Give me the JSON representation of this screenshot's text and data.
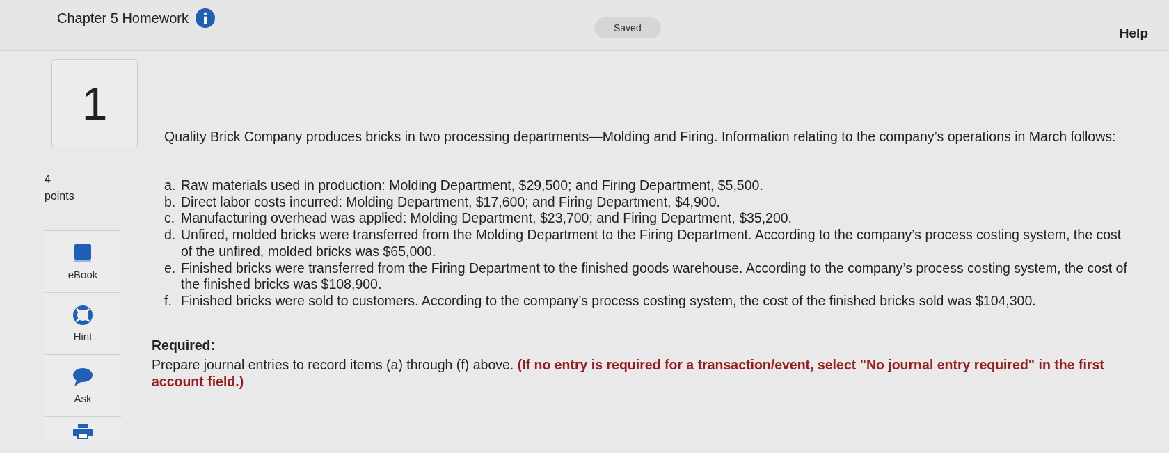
{
  "header": {
    "title": "Chapter 5 Homework",
    "status": "Saved",
    "help": "Help"
  },
  "question": {
    "number": "1",
    "points_value": "4",
    "points_label": "points"
  },
  "tools": [
    {
      "kind": "ebook",
      "label": "eBook"
    },
    {
      "kind": "hint",
      "label": "Hint"
    },
    {
      "kind": "ask",
      "label": "Ask"
    },
    {
      "kind": "print"
    }
  ],
  "intro": "Quality Brick Company produces bricks in two processing departments—Molding and Firing. Information relating to the company’s operations in March follows:",
  "items": [
    {
      "letter": "a.",
      "text": "Raw materials used in production: Molding Department, $29,500; and Firing Department, $5,500."
    },
    {
      "letter": "b.",
      "text": "Direct labor costs incurred: Molding Department, $17,600; and Firing Department, $4,900."
    },
    {
      "letter": "c.",
      "text": "Manufacturing overhead was applied: Molding Department, $23,700; and Firing Department, $35,200."
    },
    {
      "letter": "d.",
      "text": "Unfired, molded bricks were transferred from the Molding Department to the Firing Department. According to the company’s process costing system, the cost of the unfired, molded bricks was $65,000."
    },
    {
      "letter": "e.",
      "text": "Finished bricks were transferred from the Firing Department to the finished goods warehouse. According to the company’s process costing system, the cost of the finished bricks was $108,900."
    },
    {
      "letter": "f.",
      "text": "Finished bricks were sold to customers. According to the company’s process costing system, the cost of the finished bricks sold was $104,300."
    }
  ],
  "required_heading": "Required:",
  "instruction": "Prepare journal entries to record items (a) through (f) above. **(If no entry is required for a transaction/event, select \"No journal entry required\" in the first account field.)**"
}
